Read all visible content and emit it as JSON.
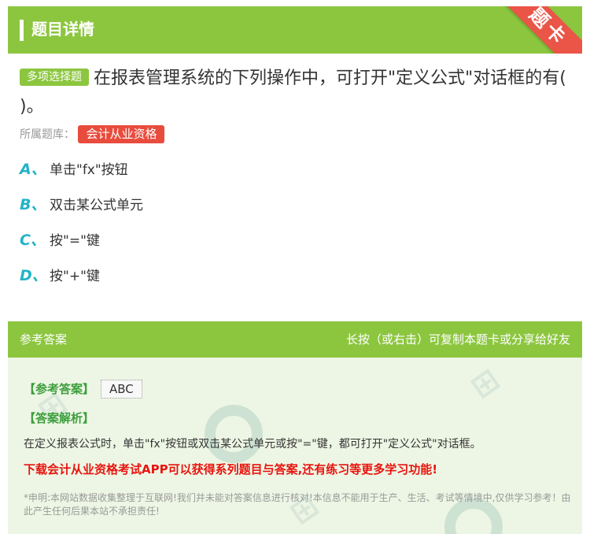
{
  "header": {
    "title": "题目详情",
    "ribbon": "题卡"
  },
  "question": {
    "type_badge": "多项选择题",
    "text": "在报表管理系统的下列操作中，可打开\"定义公式\"对话框的有( )。",
    "bank_label": "所属题库：",
    "bank_name": "会计从业资格"
  },
  "options": [
    {
      "letter": "A、",
      "text": "单击\"fx\"按钮"
    },
    {
      "letter": "B、",
      "text": "双击某公式单元"
    },
    {
      "letter": "C、",
      "text": "按\"=\"键"
    },
    {
      "letter": "D、",
      "text": "按\"+\"键"
    }
  ],
  "answer_section": {
    "title": "参考答案",
    "hint": "长按（或右击）可复制本题卡或分享给好友",
    "answer_label": "【参考答案】",
    "answer_value": "ABC",
    "explanation_label": "【答案解析】",
    "explanation": "在定义报表公式时，单击\"fx\"按钮或双击某公式单元或按\"=\"键，都可打开\"定义公式\"对话框。",
    "promo": "下载会计从业资格考试APP可以获得系列题目与答案,还有练习等更多学习功能!",
    "disclaimer": "*申明:本网站数据收集整理于互联网!我们并未能对答案信息进行核对!本信息不能用于生产、生活、考试等情境中,仅供学习参考！由此产生任何后果本站不承担责任!"
  },
  "colors": {
    "green": "#8cc63f",
    "red": "#e84c3d",
    "cyan": "#22b3c6",
    "promo_red": "#e8140f"
  }
}
